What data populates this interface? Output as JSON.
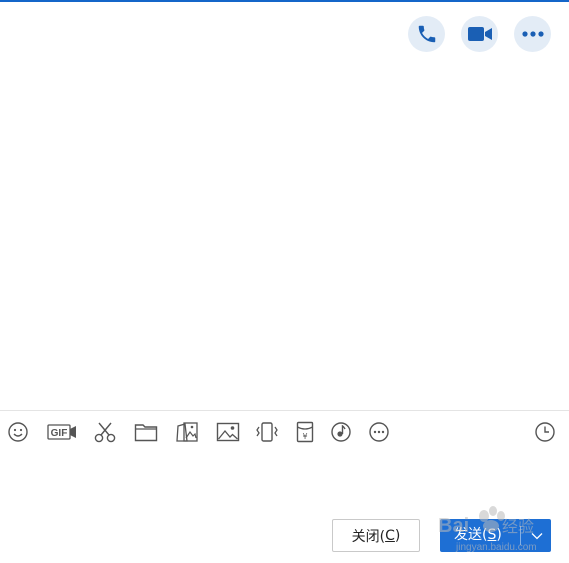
{
  "header": {
    "actions": [
      {
        "icon": "phone-icon"
      },
      {
        "icon": "video-camera-icon"
      },
      {
        "icon": "more-icon"
      }
    ]
  },
  "toolbar": {
    "items": [
      {
        "icon": "emoji-icon"
      },
      {
        "icon": "gif-icon",
        "text": "GIF"
      },
      {
        "icon": "scissors-icon"
      },
      {
        "icon": "folder-icon"
      },
      {
        "icon": "photo-album-icon"
      },
      {
        "icon": "image-icon"
      },
      {
        "icon": "vibrate-icon"
      },
      {
        "icon": "red-packet-icon",
        "text": "¥"
      },
      {
        "icon": "music-icon"
      },
      {
        "icon": "more-options-icon"
      },
      {
        "icon": "history-clock-icon"
      }
    ]
  },
  "footer": {
    "close_label": "关闭(",
    "close_mnemonic": "C",
    "close_suffix": ")",
    "send_label": "发送(",
    "send_mnemonic": "S",
    "send_suffix": ")"
  },
  "watermark": {
    "brand": "Bai",
    "brand_suffix": "经验",
    "url": "jingyan.baidu.com"
  },
  "colors": {
    "accent": "#1e6fd4",
    "top_bar": "#1466c9",
    "icon_blue": "#1a5fb4",
    "icon_gray": "#555555"
  }
}
